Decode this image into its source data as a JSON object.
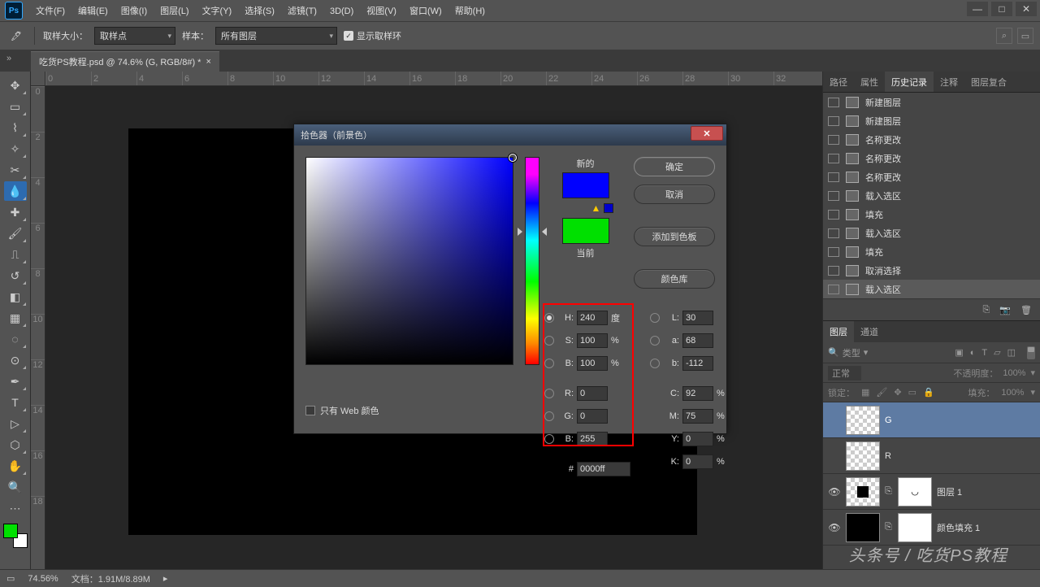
{
  "app": {
    "logo": "Ps"
  },
  "menu": [
    "文件(F)",
    "编辑(E)",
    "图像(I)",
    "图层(L)",
    "文字(Y)",
    "选择(S)",
    "滤镜(T)",
    "3D(D)",
    "视图(V)",
    "窗口(W)",
    "帮助(H)"
  ],
  "window_controls": {
    "min": "—",
    "max": "□",
    "close": "✕"
  },
  "options": {
    "sample_size_label": "取样大小：",
    "sample_size_value": "取样点",
    "sample_label": "样本：",
    "sample_value": "所有图层",
    "show_ring": "显示取样环"
  },
  "document": {
    "tab": "吃货PS教程.psd @ 74.6% (G, RGB/8#) *",
    "close": "×"
  },
  "ruler_h": [
    "0",
    "2",
    "4",
    "6",
    "8",
    "10",
    "12",
    "14",
    "16",
    "18",
    "20",
    "22",
    "24",
    "26",
    "28",
    "30",
    "32"
  ],
  "ruler_v": [
    "0",
    "2",
    "4",
    "6",
    "8",
    "10",
    "12",
    "14",
    "16",
    "18"
  ],
  "panel_tabs1": [
    "路径",
    "属性",
    "历史记录",
    "注释",
    "图层复合"
  ],
  "history": [
    {
      "label": "新建图层"
    },
    {
      "label": "新建图层"
    },
    {
      "label": "名称更改"
    },
    {
      "label": "名称更改"
    },
    {
      "label": "名称更改"
    },
    {
      "label": "载入选区"
    },
    {
      "label": "填充"
    },
    {
      "label": "载入选区"
    },
    {
      "label": "填充"
    },
    {
      "label": "取消选择"
    },
    {
      "label": "载入选区"
    }
  ],
  "panel_tabs2": [
    "图层",
    "通道"
  ],
  "layer_filter": {
    "kind": "类型"
  },
  "layer_opts": {
    "blend": "正常",
    "opacity_label": "不透明度：",
    "opacity": "100%",
    "lock_label": "锁定：",
    "fill_label": "填充：",
    "fill": "100%"
  },
  "layers": [
    {
      "name": "G",
      "eye": false,
      "mask": false,
      "sel": true,
      "thumb": "trans"
    },
    {
      "name": "R",
      "eye": false,
      "mask": false,
      "thumb": "trans"
    },
    {
      "name": "图层 1",
      "eye": true,
      "mask": true,
      "thumb": "blackinner",
      "maskglyph": "◡"
    },
    {
      "name": "颜色填充 1",
      "eye": true,
      "mask": true,
      "thumb": "black",
      "maskbg": "white"
    }
  ],
  "status": {
    "zoom": "74.56%",
    "doc": "文档：1.91M/8.89M"
  },
  "picker": {
    "title": "拾色器（前景色）",
    "new_label": "新的",
    "current_label": "当前",
    "new_color": "#0000ff",
    "current_color": "#00e000",
    "warn_color": "#0000cc",
    "btn_ok": "确定",
    "btn_cancel": "取消",
    "btn_swatch": "添加到色板",
    "btn_lib": "颜色库",
    "web_only": "只有 Web 颜色",
    "H": {
      "l": "H:",
      "v": "240",
      "u": "度"
    },
    "S": {
      "l": "S:",
      "v": "100",
      "u": "%"
    },
    "B": {
      "l": "B:",
      "v": "100",
      "u": "%"
    },
    "R": {
      "l": "R:",
      "v": "0"
    },
    "G": {
      "l": "G:",
      "v": "0"
    },
    "Bb": {
      "l": "B:",
      "v": "255"
    },
    "L": {
      "l": "L:",
      "v": "30"
    },
    "a": {
      "l": "a:",
      "v": "68"
    },
    "b": {
      "l": "b:",
      "v": "-112"
    },
    "C": {
      "l": "C:",
      "v": "92",
      "u": "%"
    },
    "M": {
      "l": "M:",
      "v": "75",
      "u": "%"
    },
    "Y": {
      "l": "Y:",
      "v": "0",
      "u": "%"
    },
    "K": {
      "l": "K:",
      "v": "0",
      "u": "%"
    },
    "hex_label": "#",
    "hex": "0000ff"
  },
  "swatch": {
    "fg": "#00e000"
  },
  "watermark": "头条号 / 吃货PS教程"
}
